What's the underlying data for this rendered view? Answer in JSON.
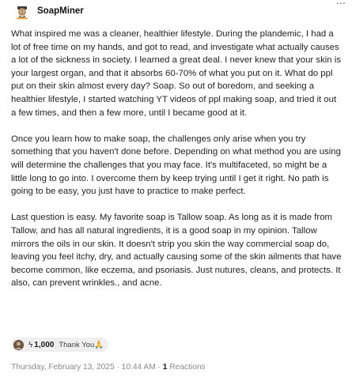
{
  "post": {
    "author": "SoapMiner",
    "more_icon": "⋯",
    "paragraphs": [
      "What inspired me was a cleaner, healthier lifestyle. During the plandemic, I had a lot of free time on my hands, and got to read, and investigate what actually causes a lot of the sickness in society. I learned a great deal. I never knew that your skin is your largest organ, and that it absorbs 60-70% of what you put on it. What do ppl put on their skin almost every day? Soap. So out of boredom, and seeking a healthier lifestyle, I started watching YT videos of ppl making soap, and tried it out a few times, and then a few more, until I became good at it.",
      "Once you learn how to make soap, the challenges only arise when you try something that you haven't done before. Depending on what method you are using will determine the challenges that you may face. It's multifaceted, so might be a little long to go into. I overcome them by keep trying until I get it right. No path is going to be easy, you just have to practice to make perfect.",
      "Last question is easy. My favorite soap is Tallow soap. As long as it is made from Tallow, and has all natural ingredients, it is a good soap in my opinion. Tallow mirrors the oils in our skin. It doesn't strip you skin the way commercial soap do, leaving you feel itchy, dry, and actually causing some of the skin ailments that have become common, like eczema, and psoriasis. Just nutures, cleans, and protects. It also, can prevent wrinkles., and acne."
    ],
    "zap": {
      "bolt_icon": "ϟ",
      "amount": "1,000",
      "message": "Thank You🙏"
    },
    "timestamp": "Thursday, February 13, 2025 · 10:44 AM ·",
    "reactions_count": "1",
    "reactions_label": "Reactions"
  },
  "colors": {
    "text": "#1f1f1f",
    "muted": "#8a8a8a",
    "pill_bg": "#efefef"
  }
}
